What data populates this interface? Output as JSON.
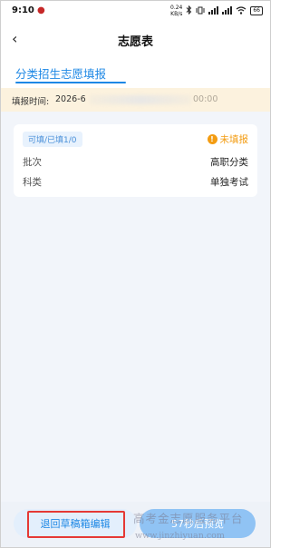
{
  "status_bar": {
    "time": "9:10",
    "speed_value": "0.24",
    "speed_unit": "KB/s",
    "battery": "66"
  },
  "nav": {
    "title": "志愿表"
  },
  "tabs": [
    {
      "label": "分类招生志愿填报",
      "active": true
    }
  ],
  "fill_time": {
    "label": "填报时间:",
    "value_visible": "2026-6",
    "value_tail": "00:00"
  },
  "card": {
    "badge": "可填/已填1/0",
    "status": "未填报",
    "rows": [
      {
        "key": "批次",
        "value": "高职分类"
      },
      {
        "key": "科类",
        "value": "单独考试"
      }
    ]
  },
  "bottom": {
    "draft_button": "退回草稿箱编辑",
    "preview_button": "57秒后预览"
  },
  "watermark": {
    "text_cn": "高考金志愿服务平台",
    "url": "www.jinzhiyuan.com"
  },
  "colors": {
    "accent": "#1e88e5",
    "warning": "#f39c12",
    "highlight": "#e53935",
    "time_bar_bg": "#fcf2de"
  }
}
